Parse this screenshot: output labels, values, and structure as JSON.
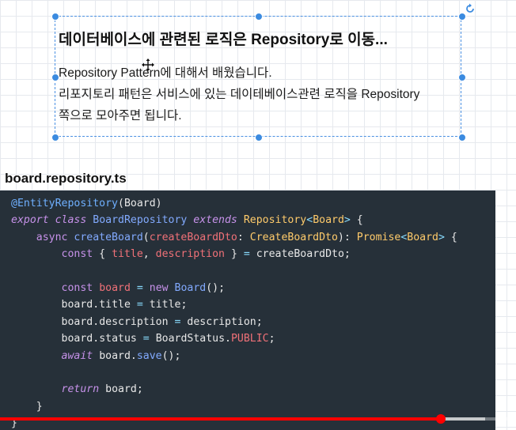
{
  "slide": {
    "heading": "데이터베이스에 관련된 로직은 Repository로 이동...",
    "lines": [
      "Repository Pattern에 대해서 배웠습니다.",
      "리포지토리 패턴은 서비스에 있는 데이테베이스관련 로직을 Repository",
      "쪽으로 모아주면 됩니다."
    ]
  },
  "code_section": {
    "filename": "board.repository.ts"
  },
  "code_tokens": {
    "decorator": "@EntityRepository",
    "board": "Board",
    "export": "export",
    "class": "class",
    "className": "BoardRepository",
    "extends": "extends",
    "repository": "Repository",
    "async": "async",
    "createBoard": "createBoard",
    "createBoardDto": "createBoardDto",
    "CreateBoardDto": "CreateBoardDto",
    "Promise": "Promise",
    "const": "const",
    "title": "title",
    "description": "description",
    "boardVar": "board",
    "new": "new",
    "status": "status",
    "BoardStatus": "BoardStatus",
    "PUBLIC": "PUBLIC",
    "await": "await",
    "save": "save",
    "return": "return"
  },
  "video": {
    "progress_fraction": 0.855,
    "buffered_fraction": 0.94
  },
  "colors": {
    "accent": "#3b8be0",
    "code_bg": "#263039",
    "progress": "#ff0000"
  }
}
